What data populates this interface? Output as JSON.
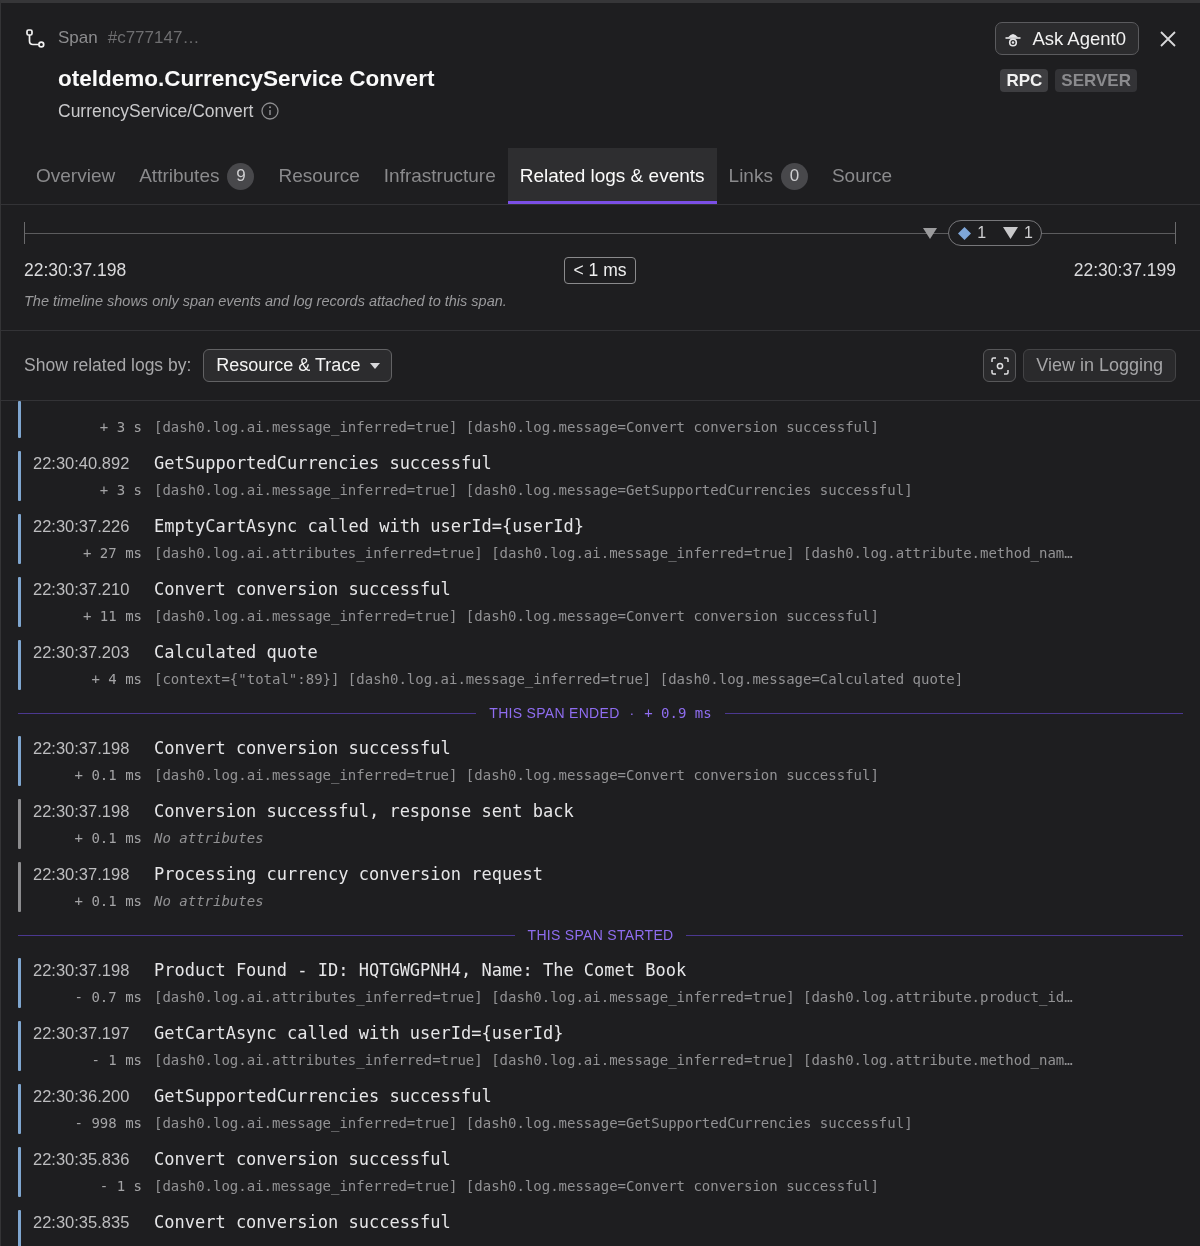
{
  "header": {
    "kind_label": "Span",
    "span_id": "#c777147…",
    "title": "oteldemo.CurrencyService Convert",
    "subtitle": "CurrencyService/Convert",
    "ask_button": "Ask Agent0",
    "badges": [
      {
        "label": "RPC",
        "highlighted": true
      },
      {
        "label": "SERVER",
        "highlighted": false
      }
    ]
  },
  "tabs": [
    {
      "label": "Overview",
      "selected": false
    },
    {
      "label": "Attributes",
      "count": "9",
      "selected": false
    },
    {
      "label": "Resource",
      "selected": false
    },
    {
      "label": "Infrastructure",
      "selected": false
    },
    {
      "label": "Related logs & events",
      "selected": true
    },
    {
      "label": "Links",
      "count": "0",
      "selected": false
    },
    {
      "label": "Source",
      "selected": false
    }
  ],
  "timeline": {
    "markers": [
      {
        "kind": "event"
      },
      {
        "kind": "cluster",
        "counts": [
          {
            "kind": "log",
            "count": "1"
          },
          {
            "kind": "event",
            "count": "1"
          }
        ]
      }
    ],
    "start": "22:30:37.198",
    "duration": "< 1 ms",
    "end": "22:30:37.199",
    "note": "The timeline shows only span events and log records attached to this span."
  },
  "controls": {
    "label": "Show related logs by:",
    "dropdown": "Resource & Trace",
    "view_button": "View in Logging"
  },
  "logs": [
    {
      "kind": "log",
      "offset": "+ 3 s",
      "attributes": "[dash0.log.ai.message_inferred=true] [dash0.log.message=Convert conversion successful]",
      "attributes_empty": false
    },
    {
      "kind": "log",
      "time": "22:30:40.892",
      "message": "GetSupportedCurrencies successful",
      "offset": "+ 3 s",
      "attributes": "[dash0.log.ai.message_inferred=true] [dash0.log.message=GetSupportedCurrencies successful]",
      "attributes_empty": false
    },
    {
      "kind": "log",
      "time": "22:30:37.226",
      "message": "EmptyCartAsync called with userId={userId}",
      "offset": "+ 27 ms",
      "attributes": "[dash0.log.ai.attributes_inferred=true] [dash0.log.ai.message_inferred=true] [dash0.log.attribute.method_nam…",
      "attributes_empty": false
    },
    {
      "kind": "log",
      "time": "22:30:37.210",
      "message": "Convert conversion successful",
      "offset": "+ 11 ms",
      "attributes": "[dash0.log.ai.message_inferred=true] [dash0.log.message=Convert conversion successful]",
      "attributes_empty": false
    },
    {
      "kind": "log",
      "time": "22:30:37.203",
      "message": "Calculated quote",
      "offset": "+ 4 ms",
      "attributes": "[context={\"total\":89}] [dash0.log.ai.message_inferred=true] [dash0.log.message=Calculated quote]",
      "attributes_empty": false
    },
    {
      "kind": "boundary",
      "label": "THIS SPAN ENDED",
      "separator": "·",
      "offset": "+ 0.9 ms"
    },
    {
      "kind": "log",
      "time": "22:30:37.198",
      "message": "Convert conversion successful",
      "offset": "+ 0.1 ms",
      "attributes": "[dash0.log.ai.message_inferred=true] [dash0.log.message=Convert conversion successful]",
      "attributes_empty": false
    },
    {
      "kind": "event",
      "time": "22:30:37.198",
      "message": "Conversion successful, response sent back",
      "offset": "+ 0.1 ms",
      "attributes": "No attributes",
      "attributes_empty": true
    },
    {
      "kind": "event",
      "time": "22:30:37.198",
      "message": "Processing currency conversion request",
      "offset": "+ 0.1 ms",
      "attributes": "No attributes",
      "attributes_empty": true
    },
    {
      "kind": "boundary",
      "label": "THIS SPAN STARTED"
    },
    {
      "kind": "log",
      "time": "22:30:37.198",
      "message": "Product Found - ID: HQTGWGPNH4, Name: The Comet Book",
      "offset": "- 0.7 ms",
      "attributes": "[dash0.log.ai.attributes_inferred=true] [dash0.log.ai.message_inferred=true] [dash0.log.attribute.product_id…",
      "attributes_empty": false
    },
    {
      "kind": "log",
      "time": "22:30:37.197",
      "message": "GetCartAsync called with userId={userId}",
      "offset": "- 1 ms",
      "attributes": "[dash0.log.ai.attributes_inferred=true] [dash0.log.ai.message_inferred=true] [dash0.log.attribute.method_nam…",
      "attributes_empty": false
    },
    {
      "kind": "log",
      "time": "22:30:36.200",
      "message": "GetSupportedCurrencies successful",
      "offset": "- 998 ms",
      "attributes": "[dash0.log.ai.message_inferred=true] [dash0.log.message=GetSupportedCurrencies successful]",
      "attributes_empty": false
    },
    {
      "kind": "log",
      "time": "22:30:35.836",
      "message": "Convert conversion successful",
      "offset": "- 1 s",
      "attributes": "[dash0.log.ai.message_inferred=true] [dash0.log.message=Convert conversion successful]",
      "attributes_empty": false
    },
    {
      "kind": "log",
      "time": "22:30:35.835",
      "message": "Convert conversion successful"
    }
  ]
}
